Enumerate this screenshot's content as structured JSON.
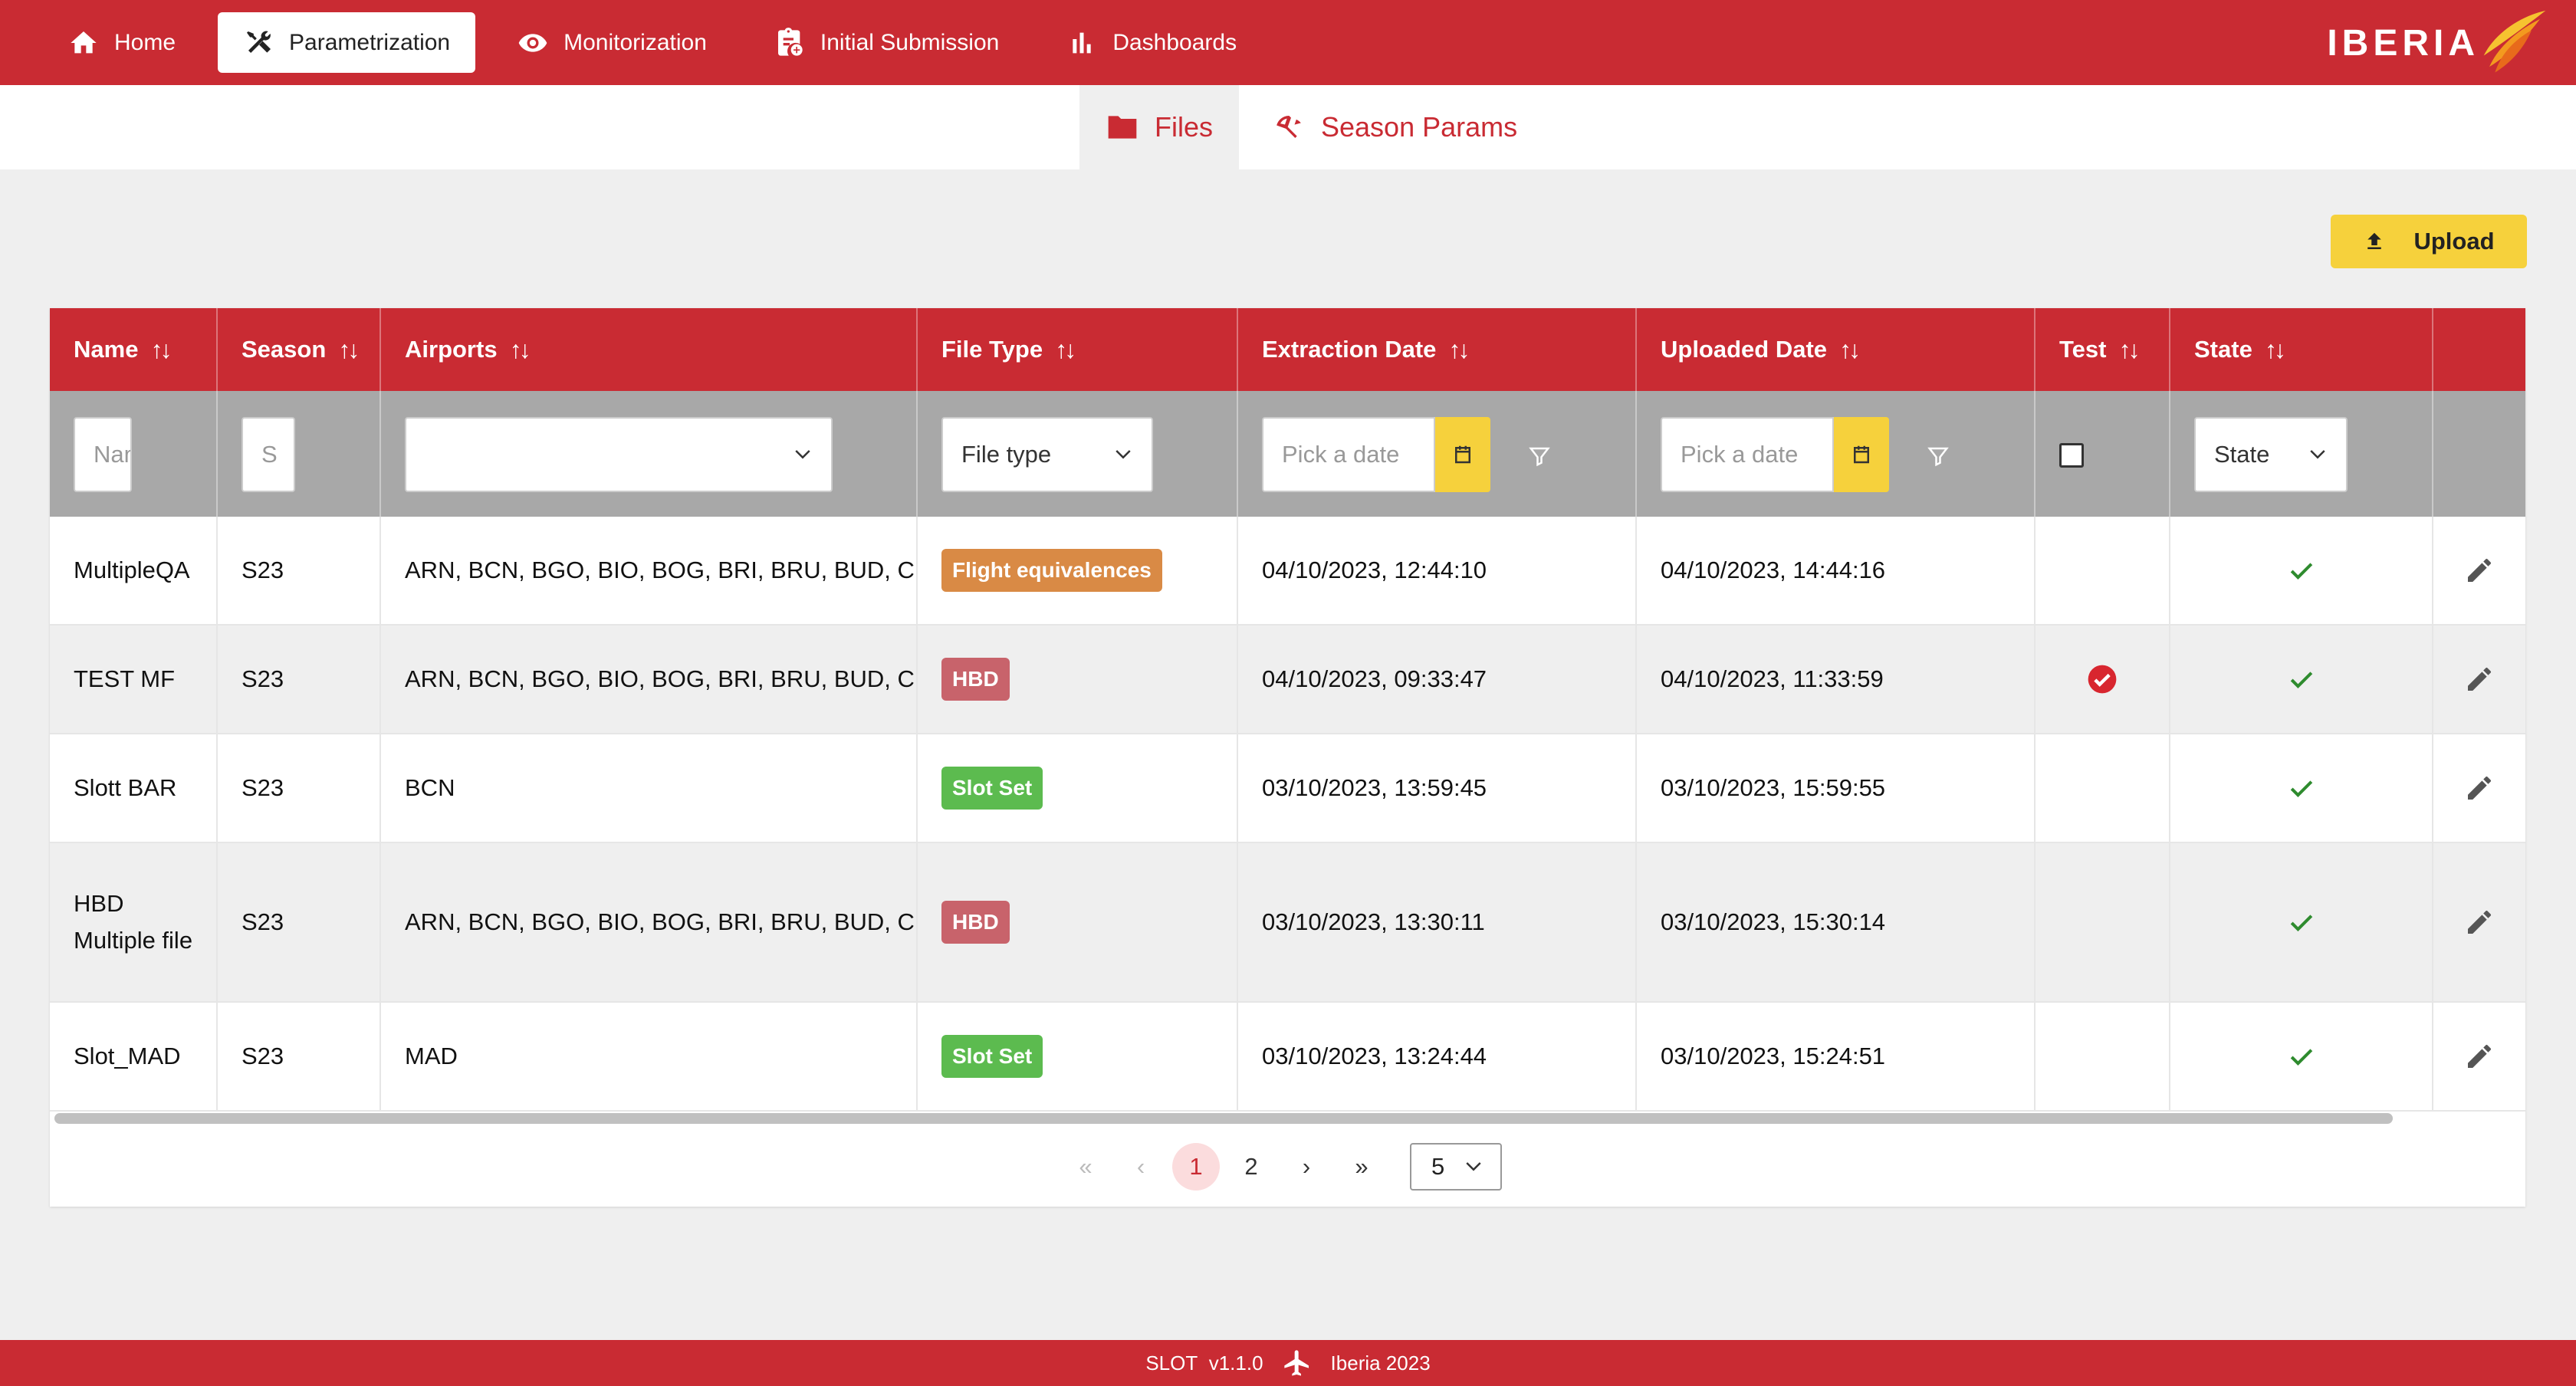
{
  "nav": {
    "items": [
      {
        "label": "Home",
        "icon": "home-icon"
      },
      {
        "label": "Parametrization",
        "icon": "tools-icon"
      },
      {
        "label": "Monitorization",
        "icon": "eye-icon"
      },
      {
        "label": "Initial Submission",
        "icon": "clipboard-add-icon"
      },
      {
        "label": "Dashboards",
        "icon": "bar-chart-icon"
      }
    ],
    "active": "Parametrization",
    "logo_text": "IBERIA"
  },
  "subtabs": [
    {
      "label": "Files",
      "icon": "folder-icon"
    },
    {
      "label": "Season Params",
      "icon": "umbrella-icon"
    }
  ],
  "upload_label": "Upload",
  "columns": [
    "Name",
    "Season",
    "Airports",
    "File Type",
    "Extraction Date",
    "Uploaded Date",
    "Test",
    "State"
  ],
  "filters": {
    "name_placeholder": "Name",
    "season_placeholder": "S",
    "airports_value": "",
    "file_type_placeholder": "File type",
    "extraction_placeholder": "Pick a date",
    "uploaded_placeholder": "Pick a date",
    "state_placeholder": "State"
  },
  "rows": [
    {
      "name": "MultipleQA",
      "season": "S23",
      "airports": "ARN, BCN, BGO, BIO, BOG, BRI, BRU, BUD, C...",
      "file_type": "Flight equivalences",
      "extraction_date": "04/10/2023, 12:44:10",
      "uploaded_date": "04/10/2023, 14:44:16",
      "test": false,
      "state": true
    },
    {
      "name": "TEST MF",
      "season": "S23",
      "airports": "ARN, BCN, BGO, BIO, BOG, BRI, BRU, BUD, C...",
      "file_type": "HBD",
      "extraction_date": "04/10/2023, 09:33:47",
      "uploaded_date": "04/10/2023, 11:33:59",
      "test": true,
      "state": true
    },
    {
      "name": "Slott BAR",
      "season": "S23",
      "airports": "BCN",
      "file_type": "Slot Set",
      "extraction_date": "03/10/2023, 13:59:45",
      "uploaded_date": "03/10/2023, 15:59:55",
      "test": false,
      "state": true
    },
    {
      "name": "HBD Multiple file",
      "season": "S23",
      "airports": "ARN, BCN, BGO, BIO, BOG, BRI, BRU, BUD, C...",
      "file_type": "HBD",
      "extraction_date": "03/10/2023, 13:30:11",
      "uploaded_date": "03/10/2023, 15:30:14",
      "test": false,
      "state": true
    },
    {
      "name": "Slot_MAD",
      "season": "S23",
      "airports": "MAD",
      "file_type": "Slot Set",
      "extraction_date": "03/10/2023, 13:24:44",
      "uploaded_date": "03/10/2023, 15:24:51",
      "test": false,
      "state": true
    }
  ],
  "badge_colors": {
    "Flight equivalences": "#d98a45",
    "HBD": "#c8636b",
    "Slot Set": "#5cbb4f"
  },
  "pagination": {
    "current": "1",
    "pages": [
      "1",
      "2"
    ],
    "page_size": "5"
  },
  "footer": {
    "app": "SLOT",
    "version": "v1.1.0",
    "company": "Iberia 2023"
  }
}
